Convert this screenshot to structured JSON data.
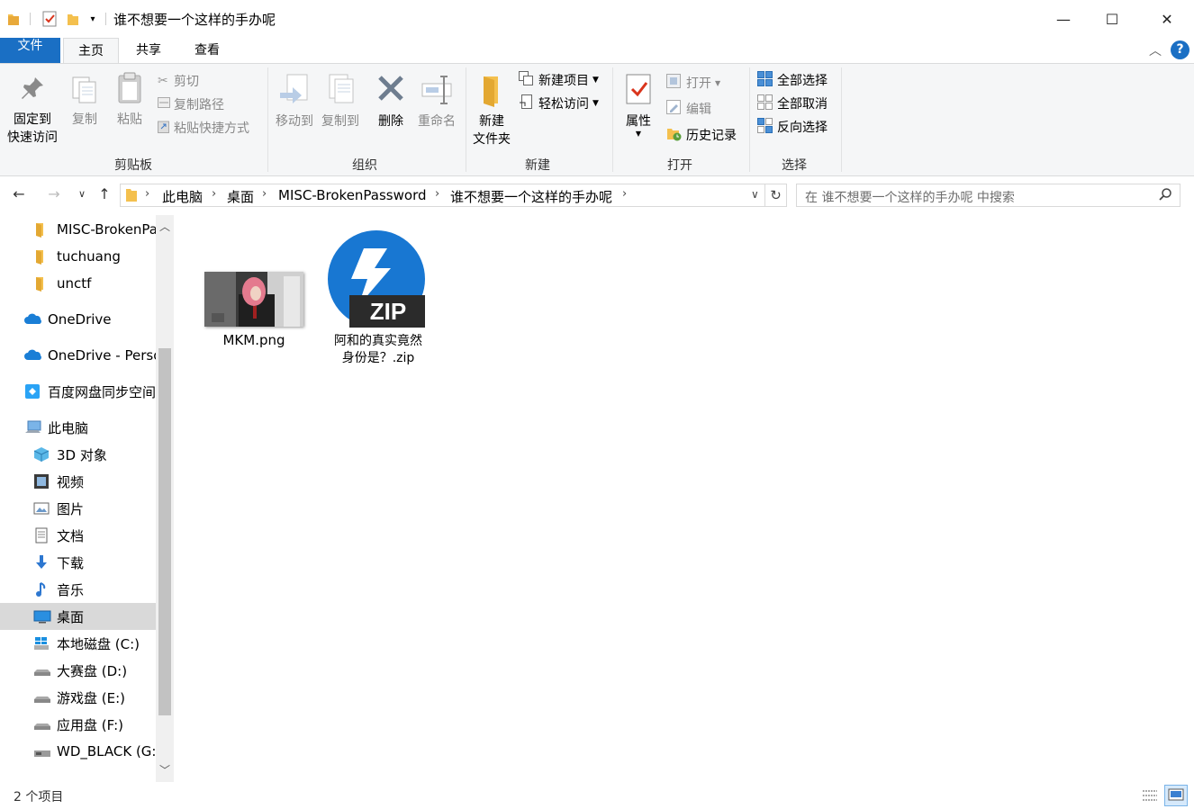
{
  "window": {
    "title": "谁不想要一个这样的手办呢",
    "minimize": "—",
    "maximize": "☐",
    "close": "✕"
  },
  "ribbon_tabs": [
    "文件",
    "主页",
    "共享",
    "查看"
  ],
  "ribbon": {
    "clipboard": {
      "label": "剪贴板",
      "pin_line1": "固定到",
      "pin_line2": "快速访问",
      "copy": "复制",
      "paste": "粘贴",
      "cut": "剪切",
      "copy_path": "复制路径",
      "paste_shortcut": "粘贴快捷方式"
    },
    "organize": {
      "label": "组织",
      "move_to": "移动到",
      "copy_to": "复制到",
      "delete": "删除",
      "rename": "重命名"
    },
    "new": {
      "label": "新建",
      "new_folder_line1": "新建",
      "new_folder_line2": "文件夹",
      "new_item": "新建项目",
      "easy_access": "轻松访问"
    },
    "open": {
      "label": "打开",
      "properties": "属性",
      "open": "打开",
      "edit": "编辑",
      "history": "历史记录"
    },
    "select": {
      "label": "选择",
      "select_all": "全部选择",
      "select_none": "全部取消",
      "invert": "反向选择"
    }
  },
  "breadcrumb": [
    "此电脑",
    "桌面",
    "MISC-BrokenPassword",
    "谁不想要一个这样的手办呢"
  ],
  "search": {
    "placeholder": "在 谁不想要一个这样的手办呢 中搜索"
  },
  "nav": {
    "items": [
      {
        "label": "MISC-BrokenPassword",
        "icon": "folder-icon"
      },
      {
        "label": "tuchuang",
        "icon": "folder-icon"
      },
      {
        "label": "unctf",
        "icon": "folder-icon"
      },
      {
        "label": "OneDrive",
        "icon": "onedrive-icon"
      },
      {
        "label": "OneDrive - Personal",
        "icon": "onedrive-icon"
      },
      {
        "label": "百度网盘同步空间",
        "icon": "baidu-netdisk-icon"
      },
      {
        "label": "此电脑",
        "icon": "this-pc-icon"
      },
      {
        "label": "3D 对象",
        "icon": "3d-objects-icon"
      },
      {
        "label": "视频",
        "icon": "videos-icon"
      },
      {
        "label": "图片",
        "icon": "pictures-icon"
      },
      {
        "label": "文档",
        "icon": "documents-icon"
      },
      {
        "label": "下载",
        "icon": "downloads-icon"
      },
      {
        "label": "音乐",
        "icon": "music-icon"
      },
      {
        "label": "桌面",
        "icon": "desktop-icon"
      },
      {
        "label": "本地磁盘 (C:)",
        "icon": "windows-drive-icon"
      },
      {
        "label": "大赛盘 (D:)",
        "icon": "drive-icon"
      },
      {
        "label": "游戏盘 (E:)",
        "icon": "drive-icon"
      },
      {
        "label": "应用盘 (F:)",
        "icon": "drive-icon"
      },
      {
        "label": "WD_BLACK (G:)",
        "icon": "usb-drive-icon"
      }
    ],
    "selected": "桌面"
  },
  "files": [
    {
      "name": "MKM.png",
      "type": "image"
    },
    {
      "name_line1": "阿和的真实竟然",
      "name_line2": "身份是？.zip",
      "type": "zip",
      "badge": "ZIP"
    }
  ],
  "status": {
    "count": "2 个项目"
  },
  "colors": {
    "accent": "#1a6fc4",
    "folder": "#f4c04e",
    "zip_blue": "#1877d2"
  }
}
